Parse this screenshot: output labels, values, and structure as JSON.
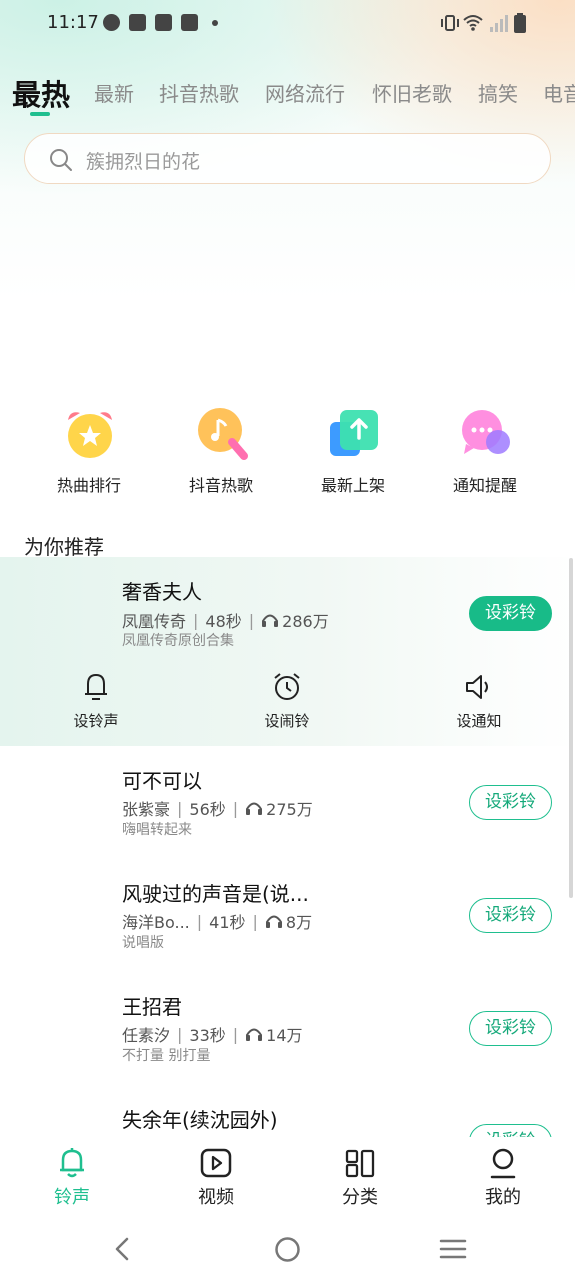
{
  "status_bar": {
    "time": "11:17"
  },
  "tabs": [
    "最热",
    "最新",
    "抖音热歌",
    "网络流行",
    "怀旧老歌",
    "搞笑",
    "电音"
  ],
  "search": {
    "placeholder": "簇拥烈日的花"
  },
  "quick_links": [
    {
      "label": "热曲排行",
      "icon": "alarm-star-icon"
    },
    {
      "label": "抖音热歌",
      "icon": "music-note-icon"
    },
    {
      "label": "最新上架",
      "icon": "upload-arrow-icon"
    },
    {
      "label": "通知提醒",
      "icon": "chat-bubble-icon"
    }
  ],
  "section_title": "为你推荐",
  "songs": [
    {
      "title": "奢香夫人",
      "artist": "凤凰传奇",
      "duration": "48秒",
      "plays": "286万",
      "subtitle": "凤凰传奇原创合集",
      "button": "设彩铃"
    },
    {
      "title": "可不可以",
      "artist": "张紫豪",
      "duration": "56秒",
      "plays": "275万",
      "subtitle": "嗨唱转起来",
      "button": "设彩铃"
    },
    {
      "title": "风驶过的声音是(说...",
      "artist": "海洋Bo...",
      "duration": "41秒",
      "plays": "8万",
      "subtitle": "说唱版",
      "button": "设彩铃"
    },
    {
      "title": "王招君",
      "artist": "任素汐",
      "duration": "33秒",
      "plays": "14万",
      "subtitle": "不打量 别打量",
      "button": "设彩铃"
    },
    {
      "title": "失余年(续沈园外)",
      "button": "设彩铃"
    }
  ],
  "actions": [
    {
      "label": "设铃声",
      "icon": "bell-icon"
    },
    {
      "label": "设闹铃",
      "icon": "alarm-clock-icon"
    },
    {
      "label": "设通知",
      "icon": "speaker-icon"
    }
  ],
  "bottom_nav": [
    {
      "label": "铃声",
      "icon": "bell-icon"
    },
    {
      "label": "视频",
      "icon": "video-play-icon"
    },
    {
      "label": "分类",
      "icon": "grid-category-icon"
    },
    {
      "label": "我的",
      "icon": "person-icon"
    }
  ],
  "colors": {
    "accent": "#1fbf8f"
  }
}
